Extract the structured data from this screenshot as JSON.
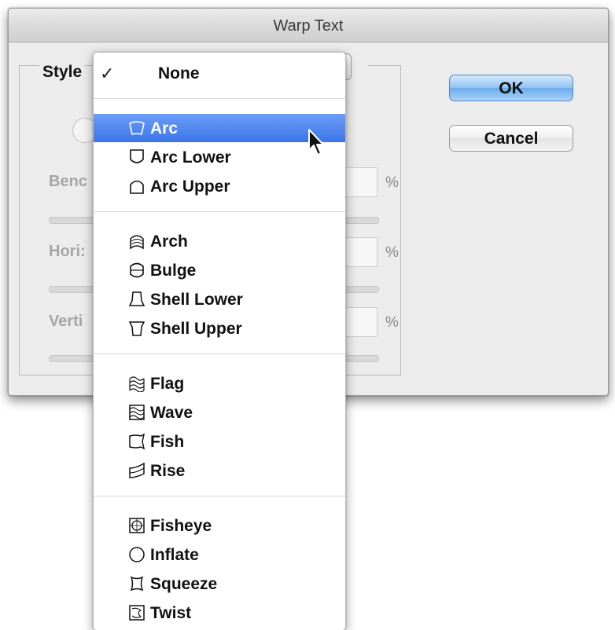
{
  "dialog": {
    "title": "Warp Text",
    "style_label": "Style",
    "faded_labels": {
      "bend": "Benc",
      "horizontal": "Hori:",
      "vertical": "Verti"
    },
    "percent": "%",
    "ok_label": "OK",
    "cancel_label": "Cancel"
  },
  "menu": {
    "none_item": {
      "check": "✓",
      "label": "None"
    },
    "items": [
      {
        "label": "Arc",
        "icon": "arc-icon",
        "selected": true
      },
      {
        "label": "Arc Lower",
        "icon": "arc-lower-icon"
      },
      {
        "label": "Arc Upper",
        "icon": "arc-upper-icon"
      },
      {
        "label": "Arch",
        "icon": "arch-icon"
      },
      {
        "label": "Bulge",
        "icon": "bulge-icon"
      },
      {
        "label": "Shell Lower",
        "icon": "shell-lower-icon"
      },
      {
        "label": "Shell Upper",
        "icon": "shell-upper-icon"
      },
      {
        "label": "Flag",
        "icon": "flag-icon"
      },
      {
        "label": "Wave",
        "icon": "wave-icon"
      },
      {
        "label": "Fish",
        "icon": "fish-icon"
      },
      {
        "label": "Rise",
        "icon": "rise-icon"
      },
      {
        "label": "Fisheye",
        "icon": "fisheye-icon"
      },
      {
        "label": "Inflate",
        "icon": "inflate-icon"
      },
      {
        "label": "Squeeze",
        "icon": "squeeze-icon"
      },
      {
        "label": "Twist",
        "icon": "twist-icon"
      }
    ]
  },
  "colors": {
    "selection": "#3d75ea",
    "ok_button": "#6aaaea"
  }
}
